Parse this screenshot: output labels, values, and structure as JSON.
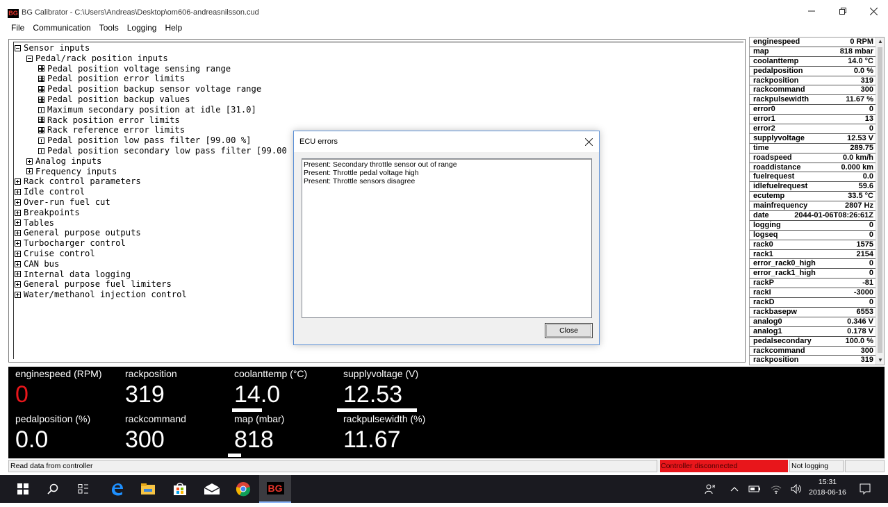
{
  "window": {
    "title": "BG Calibrator - C:\\Users\\Andreas\\Desktop\\om606-andreasnilsson.cud",
    "icon_text": "BG",
    "min_icon": "minimize-icon",
    "max_icon": "maximize-icon",
    "close_icon": "close-icon"
  },
  "menu": [
    "File",
    "Communication",
    "Tools",
    "Logging",
    "Help"
  ],
  "tree": [
    {
      "label": "Sensor inputs",
      "level": 0,
      "box": "minus"
    },
    {
      "label": "Pedal/rack position inputs",
      "level": 1,
      "box": "minus"
    },
    {
      "label": "Pedal position voltage sensing range",
      "level": 2,
      "box": "grid"
    },
    {
      "label": "Pedal position error limits",
      "level": 2,
      "box": "grid"
    },
    {
      "label": "Pedal position backup sensor voltage range",
      "level": 2,
      "box": "grid"
    },
    {
      "label": "Pedal position backup values",
      "level": 2,
      "box": "grid"
    },
    {
      "label": "Maximum secondary position at idle [31.0]",
      "level": 2,
      "box": "single"
    },
    {
      "label": "Rack position error limits",
      "level": 2,
      "box": "grid"
    },
    {
      "label": "Rack reference error limits",
      "level": 2,
      "box": "grid"
    },
    {
      "label": "Pedal position low pass filter [99.00 %]",
      "level": 2,
      "box": "single"
    },
    {
      "label": "Pedal position secondary low pass filter [99.00",
      "level": 2,
      "box": "single"
    },
    {
      "label": "Analog inputs",
      "level": 1,
      "box": "plus"
    },
    {
      "label": "Frequency inputs",
      "level": 1,
      "box": "plus"
    },
    {
      "label": "Rack control parameters",
      "level": 0,
      "box": "plus"
    },
    {
      "label": "Idle control",
      "level": 0,
      "box": "plus"
    },
    {
      "label": "Over-run fuel cut",
      "level": 0,
      "box": "plus"
    },
    {
      "label": "Breakpoints",
      "level": 0,
      "box": "plus"
    },
    {
      "label": "Tables",
      "level": 0,
      "box": "plus"
    },
    {
      "label": "General purpose outputs",
      "level": 0,
      "box": "plus"
    },
    {
      "label": "Turbocharger control",
      "level": 0,
      "box": "plus"
    },
    {
      "label": "Cruise control",
      "level": 0,
      "box": "plus"
    },
    {
      "label": "CAN bus",
      "level": 0,
      "box": "plus"
    },
    {
      "label": "Internal data logging",
      "level": 0,
      "box": "plus"
    },
    {
      "label": "General purpose fuel limiters",
      "level": 0,
      "box": "plus"
    },
    {
      "label": "Water/methanol injection control",
      "level": 0,
      "box": "plus"
    }
  ],
  "variables": [
    {
      "name": "enginespeed",
      "value": "0 RPM"
    },
    {
      "name": "map",
      "value": "818 mbar"
    },
    {
      "name": "coolanttemp",
      "value": "14.0 °C"
    },
    {
      "name": "pedalposition",
      "value": "0.0 %"
    },
    {
      "name": "rackposition",
      "value": "319"
    },
    {
      "name": "rackcommand",
      "value": "300"
    },
    {
      "name": "rackpulsewidth",
      "value": "11.67 %"
    },
    {
      "name": "error0",
      "value": "0"
    },
    {
      "name": "error1",
      "value": "13"
    },
    {
      "name": "error2",
      "value": "0"
    },
    {
      "name": "supplyvoltage",
      "value": "12.53 V"
    },
    {
      "name": "time",
      "value": "289.75"
    },
    {
      "name": "roadspeed",
      "value": "0.0 km/h"
    },
    {
      "name": "roaddistance",
      "value": "0.000 km"
    },
    {
      "name": "fuelrequest",
      "value": "0.0"
    },
    {
      "name": "idlefuelrequest",
      "value": "59.6"
    },
    {
      "name": "ecutemp",
      "value": "33.5 °C"
    },
    {
      "name": "mainfrequency",
      "value": "2807 Hz"
    },
    {
      "name": "date",
      "value": "2044-01-06T08:26:61Z"
    },
    {
      "name": "logging",
      "value": "0"
    },
    {
      "name": "logseq",
      "value": "0"
    },
    {
      "name": "rack0",
      "value": "1575"
    },
    {
      "name": "rack1",
      "value": "2154"
    },
    {
      "name": "error_rack0_high",
      "value": "0"
    },
    {
      "name": "error_rack1_high",
      "value": "0"
    },
    {
      "name": "rackP",
      "value": "-81"
    },
    {
      "name": "rackI",
      "value": "-3000"
    },
    {
      "name": "rackD",
      "value": "0"
    },
    {
      "name": "rackbasepw",
      "value": "6553"
    },
    {
      "name": "analog0",
      "value": "0.346 V"
    },
    {
      "name": "analog1",
      "value": "0.178 V"
    },
    {
      "name": "pedalsecondary",
      "value": "100.0 %"
    },
    {
      "name": "rackcommand",
      "value": "300"
    },
    {
      "name": "rackposition",
      "value": "319"
    }
  ],
  "gauges": {
    "enginespeed": {
      "label": "enginespeed (RPM)",
      "value": "0",
      "color": "#e8161b"
    },
    "rackposition": {
      "label": "rackposition",
      "value": "319"
    },
    "coolanttemp": {
      "label": "coolanttemp (°C)",
      "value": "14.0",
      "bar_fraction": 0.27
    },
    "supplyvoltage": {
      "label": "supplyvoltage (V)",
      "value": "12.53",
      "bar_fraction": 0.72
    },
    "pedalposition": {
      "label": "pedalposition (%)",
      "value": "0.0"
    },
    "rackcommand": {
      "label": "rackcommand",
      "value": "300"
    },
    "map": {
      "label": "map (mbar)",
      "value": "818",
      "bar_fraction": 0.12
    },
    "rackpulsewidth": {
      "label": "rackpulsewidth (%)",
      "value": "11.67"
    }
  },
  "status": {
    "message": "Read data from controller",
    "connection": "Controller disconnected",
    "logging": "Not logging",
    "connection_color": "#e8161b"
  },
  "dialog": {
    "title": "ECU errors",
    "items": [
      "Present: Secondary throttle sensor out of range",
      "Present: Throttle pedal voltage high",
      "Present: Throttle sensors disagree"
    ],
    "close_button": "Close"
  },
  "taskbar": {
    "time": "15:31",
    "date": "2018-06-16",
    "active_app": "BG"
  }
}
